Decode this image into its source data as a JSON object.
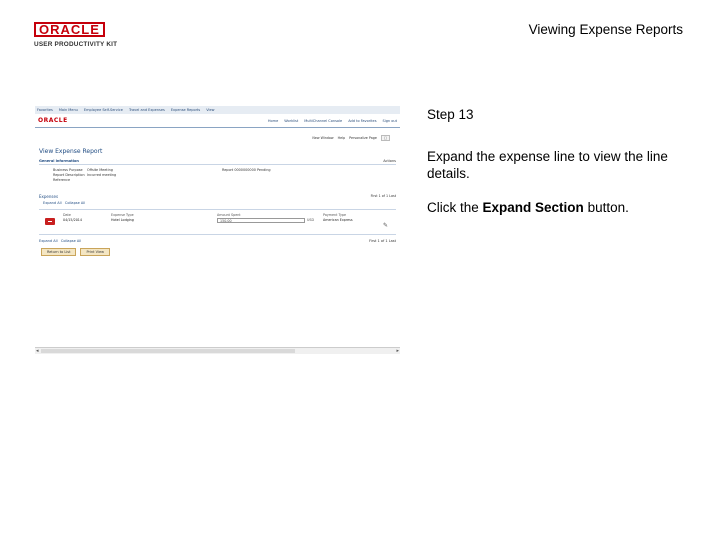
{
  "header": {
    "logo_brand": "ORACLE",
    "logo_product": "USER PRODUCTIVITY KIT",
    "document_title": "Viewing Expense Reports"
  },
  "screenshot": {
    "topbar_items": [
      "Favorites",
      "Main Menu",
      "Employee Self-Service",
      "Travel and Expenses",
      "Expense Reports",
      "View"
    ],
    "app_logo": "ORACLE",
    "header_links": [
      "Home",
      "Worklist",
      "MultiChannel Console",
      "Add to Favorites",
      "Sign out"
    ],
    "subbar": {
      "new_window": "New Window",
      "help": "Help",
      "personalize": "Personalize Page"
    },
    "page_title": "View Expense Report",
    "general_info": {
      "heading": "General Information",
      "right_label": "Actions"
    },
    "fields": {
      "business_purpose_label": "Business Purpose",
      "business_purpose_value": "Offsite Meeting",
      "report_label": "Report",
      "report_value": "0000000000 Pending",
      "report_description_label": "Report Description",
      "report_description_value": "Incurred meeting",
      "reference_label": "Reference"
    },
    "expenses": {
      "heading": "Expenses",
      "expand_all": "Expand All",
      "collapse_all": "Collapse All",
      "right_label": "First  1 of 1  Last"
    },
    "line": {
      "date_label": "Date",
      "date_value": "04/15/2014",
      "expense_type_label": "Expense Type",
      "expense_type_value": "Hotel Lodging",
      "amount_label": "Amount Spent",
      "amount_value": "150.00",
      "currency": "USD",
      "payment_type_label": "Payment Type",
      "payment_type_value": "American Express",
      "row_footer_right": "First  1 of 1  Last"
    },
    "bottom": {
      "expand_all": "Expand All",
      "collapse_all": "Collapse All",
      "right_label": "First  1 of 1  Last"
    },
    "buttons": {
      "return": "Return to List",
      "print": "Print View"
    }
  },
  "instructions": {
    "step": "Step 13",
    "text": "Expand the expense line to view the line details.",
    "action_prefix": "Click the ",
    "action_target": "Expand Section",
    "action_suffix": " button."
  }
}
